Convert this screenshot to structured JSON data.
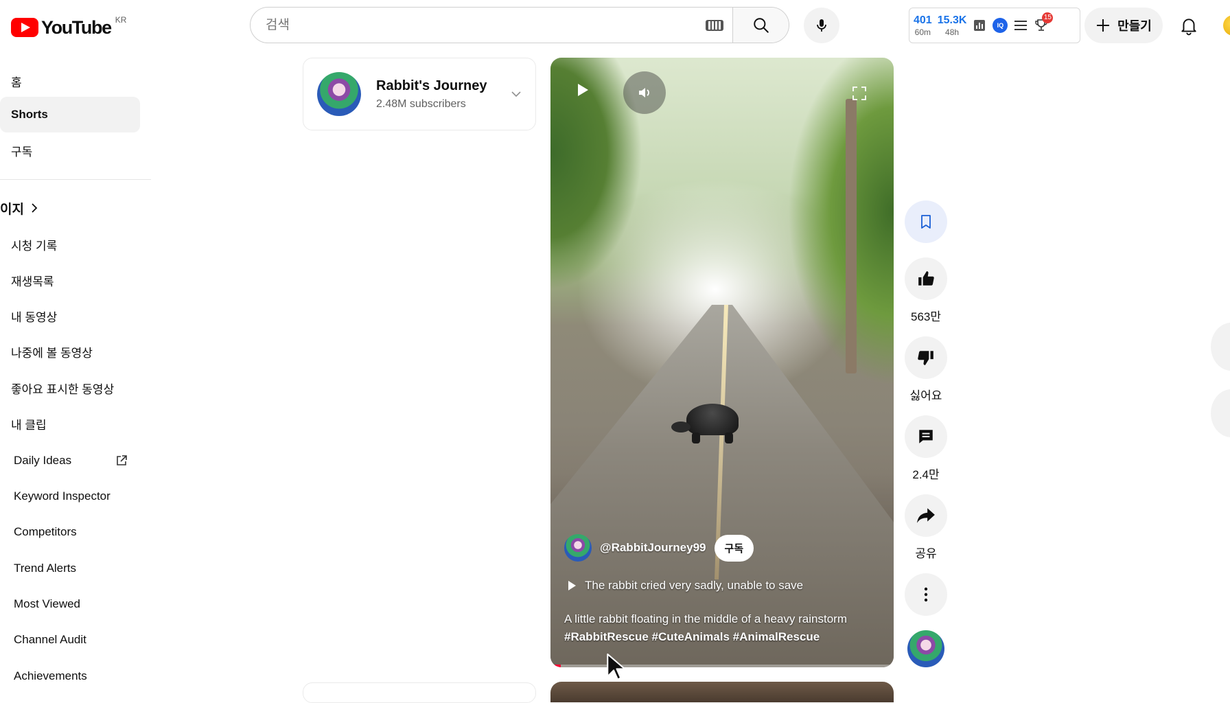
{
  "header": {
    "logo_text": "YouTube",
    "region": "KR",
    "search_placeholder": "검색",
    "create_label": "만들기",
    "extension": {
      "stat1_value": "401",
      "stat1_unit": "60m",
      "stat2_value": "15.3K",
      "stat2_unit": "48h",
      "iq_label": "IQ",
      "trophy_badge": "15"
    }
  },
  "sidebar": {
    "top_items": [
      {
        "label": "홈"
      },
      {
        "label": "Shorts",
        "active": true
      },
      {
        "label": "구독"
      }
    ],
    "section_title": "이지",
    "you_items": [
      {
        "label": "시청 기록"
      },
      {
        "label": "재생목록"
      },
      {
        "label": "내 동영상"
      },
      {
        "label": "나중에 볼 동영상"
      },
      {
        "label": "좋아요 표시한 동영상"
      },
      {
        "label": "내 클립"
      }
    ],
    "extension_items": [
      {
        "label": "Daily Ideas",
        "external": true
      },
      {
        "label": "Keyword Inspector"
      },
      {
        "label": "Competitors"
      },
      {
        "label": "Trend Alerts"
      },
      {
        "label": "Most Viewed"
      },
      {
        "label": "Channel Audit"
      },
      {
        "label": "Achievements"
      }
    ]
  },
  "channel_card": {
    "name": "Rabbit's Journey",
    "subscribers": "2.48M subscribers"
  },
  "short": {
    "handle": "@RabbitJourney99",
    "subscribe_label": "구독",
    "related_title": "The rabbit cried very sadly, unable to save",
    "description": "A little rabbit floating in the middle of a heavy rainstorm",
    "hashtags": "#RabbitRescue #CuteAnimals #AnimalRescue",
    "progress": 0.03
  },
  "actions": {
    "like_count": "563만",
    "dislike_label": "싫어요",
    "comment_count": "2.4만",
    "share_label": "공유"
  },
  "colors": {
    "brand_red": "#ff0000",
    "accent_blue": "#1a73e8",
    "progress_red": "#ff0033"
  }
}
